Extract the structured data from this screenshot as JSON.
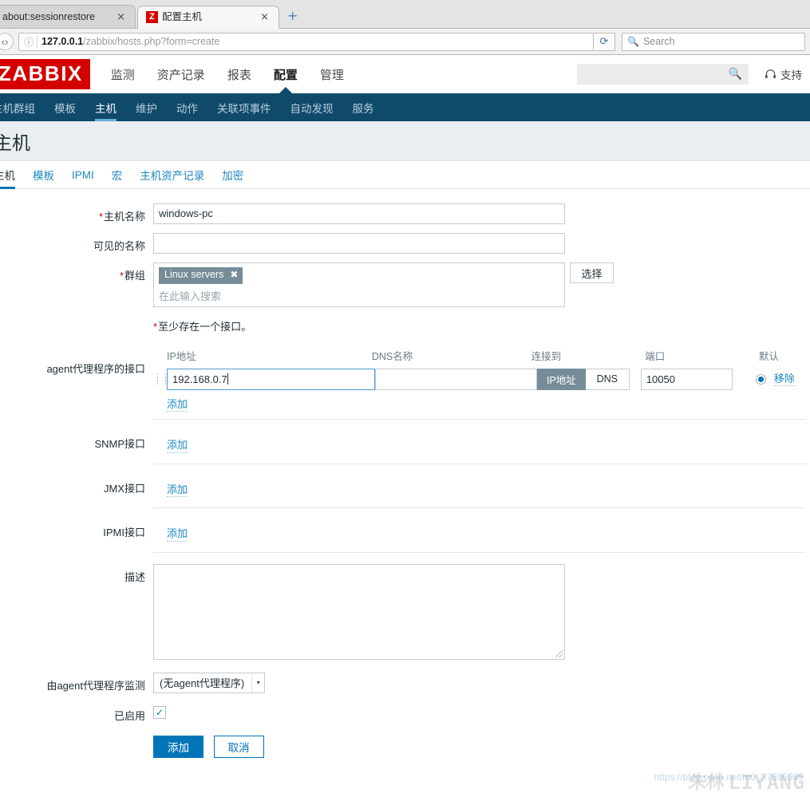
{
  "browser": {
    "tabs": [
      {
        "title": "about:sessionrestore",
        "favicon": "",
        "active": false,
        "close_label": "×"
      },
      {
        "title": "配置主机",
        "favicon": "Z",
        "active": true,
        "close_label": "×"
      }
    ],
    "new_tab_label": "+",
    "url_host": "127.0.0.1",
    "url_path": "/zabbix/hosts.php?form=create",
    "reload_label": "⟳",
    "info_icon": "ⓘ",
    "search_placeholder": "Search",
    "search_icon": "🔍"
  },
  "header": {
    "logo": "ZABBIX",
    "main_nav": [
      {
        "label": "监测",
        "active": false
      },
      {
        "label": "资产记录",
        "active": false
      },
      {
        "label": "报表",
        "active": false
      },
      {
        "label": "配置",
        "active": true
      },
      {
        "label": "管理",
        "active": false
      }
    ],
    "search_value": "",
    "search_icon": "🔍",
    "support_label": "支持"
  },
  "subnav": {
    "items": [
      {
        "label": "主机群组",
        "active": false
      },
      {
        "label": "模板",
        "active": false
      },
      {
        "label": "主机",
        "active": true
      },
      {
        "label": "维护",
        "active": false
      },
      {
        "label": "动作",
        "active": false
      },
      {
        "label": "关联项事件",
        "active": false
      },
      {
        "label": "自动发现",
        "active": false
      },
      {
        "label": "服务",
        "active": false
      }
    ]
  },
  "page": {
    "title": "主机"
  },
  "form_tabs": [
    {
      "label": "主机",
      "active": true
    },
    {
      "label": "模板",
      "active": false
    },
    {
      "label": "IPMI",
      "active": false
    },
    {
      "label": "宏",
      "active": false
    },
    {
      "label": "主机资产记录",
      "active": false
    },
    {
      "label": "加密",
      "active": false
    }
  ],
  "form": {
    "host_name": {
      "label": "主机名称",
      "required": true,
      "value": "windows-pc"
    },
    "visible_name": {
      "label": "可见的名称",
      "required": false,
      "value": ""
    },
    "groups": {
      "label": "群组",
      "required": true,
      "chips": [
        {
          "text": "Linux servers",
          "remove_label": "✖"
        }
      ],
      "placeholder": "在此输入搜索",
      "select_button": "选择"
    },
    "interface_hint": "至少存在一个接口。",
    "agent_interfaces": {
      "label": "agent代理程序的接口",
      "columns": {
        "ip": "IP地址",
        "dns": "DNS名称",
        "connect_to": "连接到",
        "port": "端口",
        "default": "默认"
      },
      "rows": [
        {
          "ip": "192.168.0.7",
          "dns": "",
          "connect_to_ip_label": "IP地址",
          "connect_to_dns_label": "DNS",
          "connect_to_selected": "ip",
          "port": "10050",
          "is_default": true,
          "remove_label": "移除"
        }
      ],
      "add_label": "添加"
    },
    "snmp_interfaces": {
      "label": "SNMP接口",
      "add_label": "添加"
    },
    "jmx_interfaces": {
      "label": "JMX接口",
      "add_label": "添加"
    },
    "ipmi_interfaces": {
      "label": "IPMI接口",
      "add_label": "添加"
    },
    "description": {
      "label": "描述",
      "value": ""
    },
    "monitored_by_proxy": {
      "label": "由agent代理程序监测",
      "selected": "(无agent代理程序)",
      "arrow": "▾"
    },
    "enabled": {
      "label": "已启用",
      "checked": true,
      "check_glyph": "✓"
    },
    "actions": {
      "submit": "添加",
      "cancel": "取消"
    }
  },
  "watermark": {
    "url": "https://blog.csdn.net/m0_37595989",
    "cn": "朱林",
    "en": "LIYANG"
  }
}
